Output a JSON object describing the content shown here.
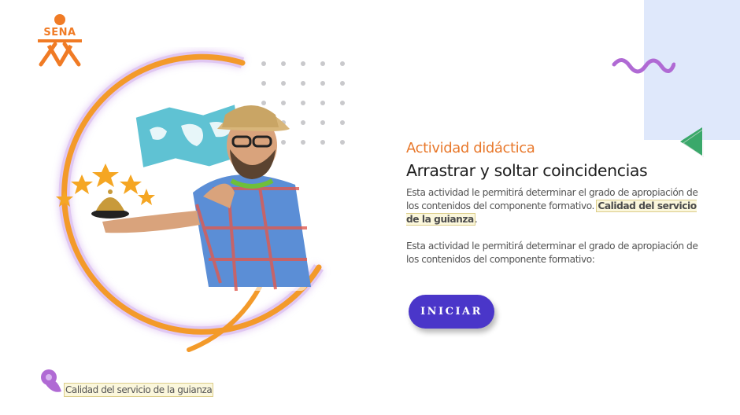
{
  "brand": {
    "logo_text": "SENA",
    "color": "#f07b25"
  },
  "activity": {
    "eyebrow": "Actividad didáctica",
    "title": "Arrastrar y soltar coincidencias",
    "para1_text": "Esta actividad le permitirá determinar el grado de apropiación de los contenidos del componente formativo. ",
    "para1_highlight": "Calidad del servicio de la guianza",
    "para1_end": ".",
    "para2": "Esta actividad le permitirá determinar el grado de apropiación de los contenidos del componente formativo:"
  },
  "button": {
    "label": "INICIAR",
    "color": "#4a36c9"
  },
  "footer": {
    "label": "Calidad del servicio de la guianza"
  },
  "colors": {
    "accent_orange": "#e8782b",
    "accent_purple": "#b06ad4",
    "accent_green": "#3aa86a",
    "panel_blue": "#dfe8fb"
  }
}
